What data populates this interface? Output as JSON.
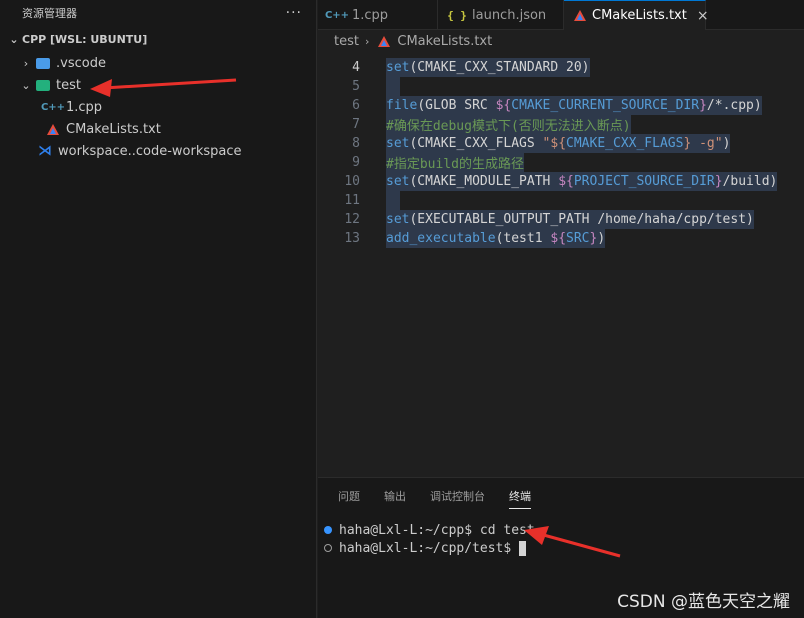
{
  "sidebar": {
    "title": "资源管理器",
    "more": "···",
    "section": "CPP [WSL: UBUNTU]",
    "items": [
      {
        "label": ".vscode",
        "chevron": "›"
      },
      {
        "label": "test",
        "chevron": "⌄"
      },
      {
        "label": "1.cpp",
        "icon": "C++"
      },
      {
        "label": "CMakeLists.txt"
      },
      {
        "label": "workspace..code-workspace"
      }
    ]
  },
  "tabs": [
    {
      "label": "1.cpp",
      "icon": "C++"
    },
    {
      "label": "launch.json",
      "icon": "{ }"
    },
    {
      "label": "CMakeLists.txt",
      "close": "×"
    }
  ],
  "breadcrumb": {
    "folder": "test",
    "sep": "›",
    "file": "CMakeLists.txt"
  },
  "editor": {
    "lines": [
      {
        "n": "4",
        "parts": [
          [
            "kw",
            "set"
          ],
          [
            "plain",
            "(CMAKE_CXX_STANDARD 20)"
          ]
        ]
      },
      {
        "n": "5",
        "parts": []
      },
      {
        "n": "6",
        "parts": [
          [
            "kw",
            "file"
          ],
          [
            "plain",
            "(GLOB SRC "
          ],
          [
            "var",
            "${"
          ],
          [
            "kw",
            "CMAKE_CURRENT_SOURCE_DIR"
          ],
          [
            "var",
            "}"
          ],
          [
            "plain",
            "/*.cpp)"
          ]
        ]
      },
      {
        "n": "7",
        "parts": [
          [
            "cm",
            "#确保在debug模式下(否则无法进入断点)"
          ]
        ]
      },
      {
        "n": "8",
        "parts": [
          [
            "kw",
            "set"
          ],
          [
            "plain",
            "(CMAKE_CXX_FLAGS "
          ],
          [
            "str",
            "\"${"
          ],
          [
            "kw",
            "CMAKE_CXX_FLAGS"
          ],
          [
            "str",
            "} -g\""
          ],
          [
            "plain",
            ")"
          ]
        ]
      },
      {
        "n": "9",
        "parts": [
          [
            "cm",
            "#指定build的生成路径"
          ]
        ]
      },
      {
        "n": "10",
        "parts": [
          [
            "kw",
            "set"
          ],
          [
            "plain",
            "(CMAKE_MODULE_PATH "
          ],
          [
            "var",
            "${"
          ],
          [
            "kw",
            "PROJECT_SOURCE_DIR"
          ],
          [
            "var",
            "}"
          ],
          [
            "plain",
            "/build)"
          ]
        ]
      },
      {
        "n": "11",
        "parts": []
      },
      {
        "n": "12",
        "parts": [
          [
            "kw",
            "set"
          ],
          [
            "plain",
            "(EXECUTABLE_OUTPUT_PATH /home/haha/cpp/test)"
          ]
        ]
      },
      {
        "n": "13",
        "parts": [
          [
            "kw",
            "add_executable"
          ],
          [
            "plain",
            "(test1 "
          ],
          [
            "var",
            "${"
          ],
          [
            "kw",
            "SRC"
          ],
          [
            "var",
            "}"
          ],
          [
            "plain",
            ")"
          ]
        ]
      }
    ]
  },
  "panel": {
    "tabs": [
      "问题",
      "输出",
      "调试控制台",
      "终端"
    ],
    "terminal": [
      {
        "prompt": "haha@Lxl-L:~/cpp$",
        "cmd": " cd test"
      },
      {
        "prompt": "haha@Lxl-L:~/cpp/test$",
        "cmd": ""
      }
    ]
  },
  "watermark": "CSDN @蓝色天空之耀",
  "colors": {
    "arrow": "#e8302a",
    "accent": "#0078d4",
    "selection": "#3a4f70"
  }
}
